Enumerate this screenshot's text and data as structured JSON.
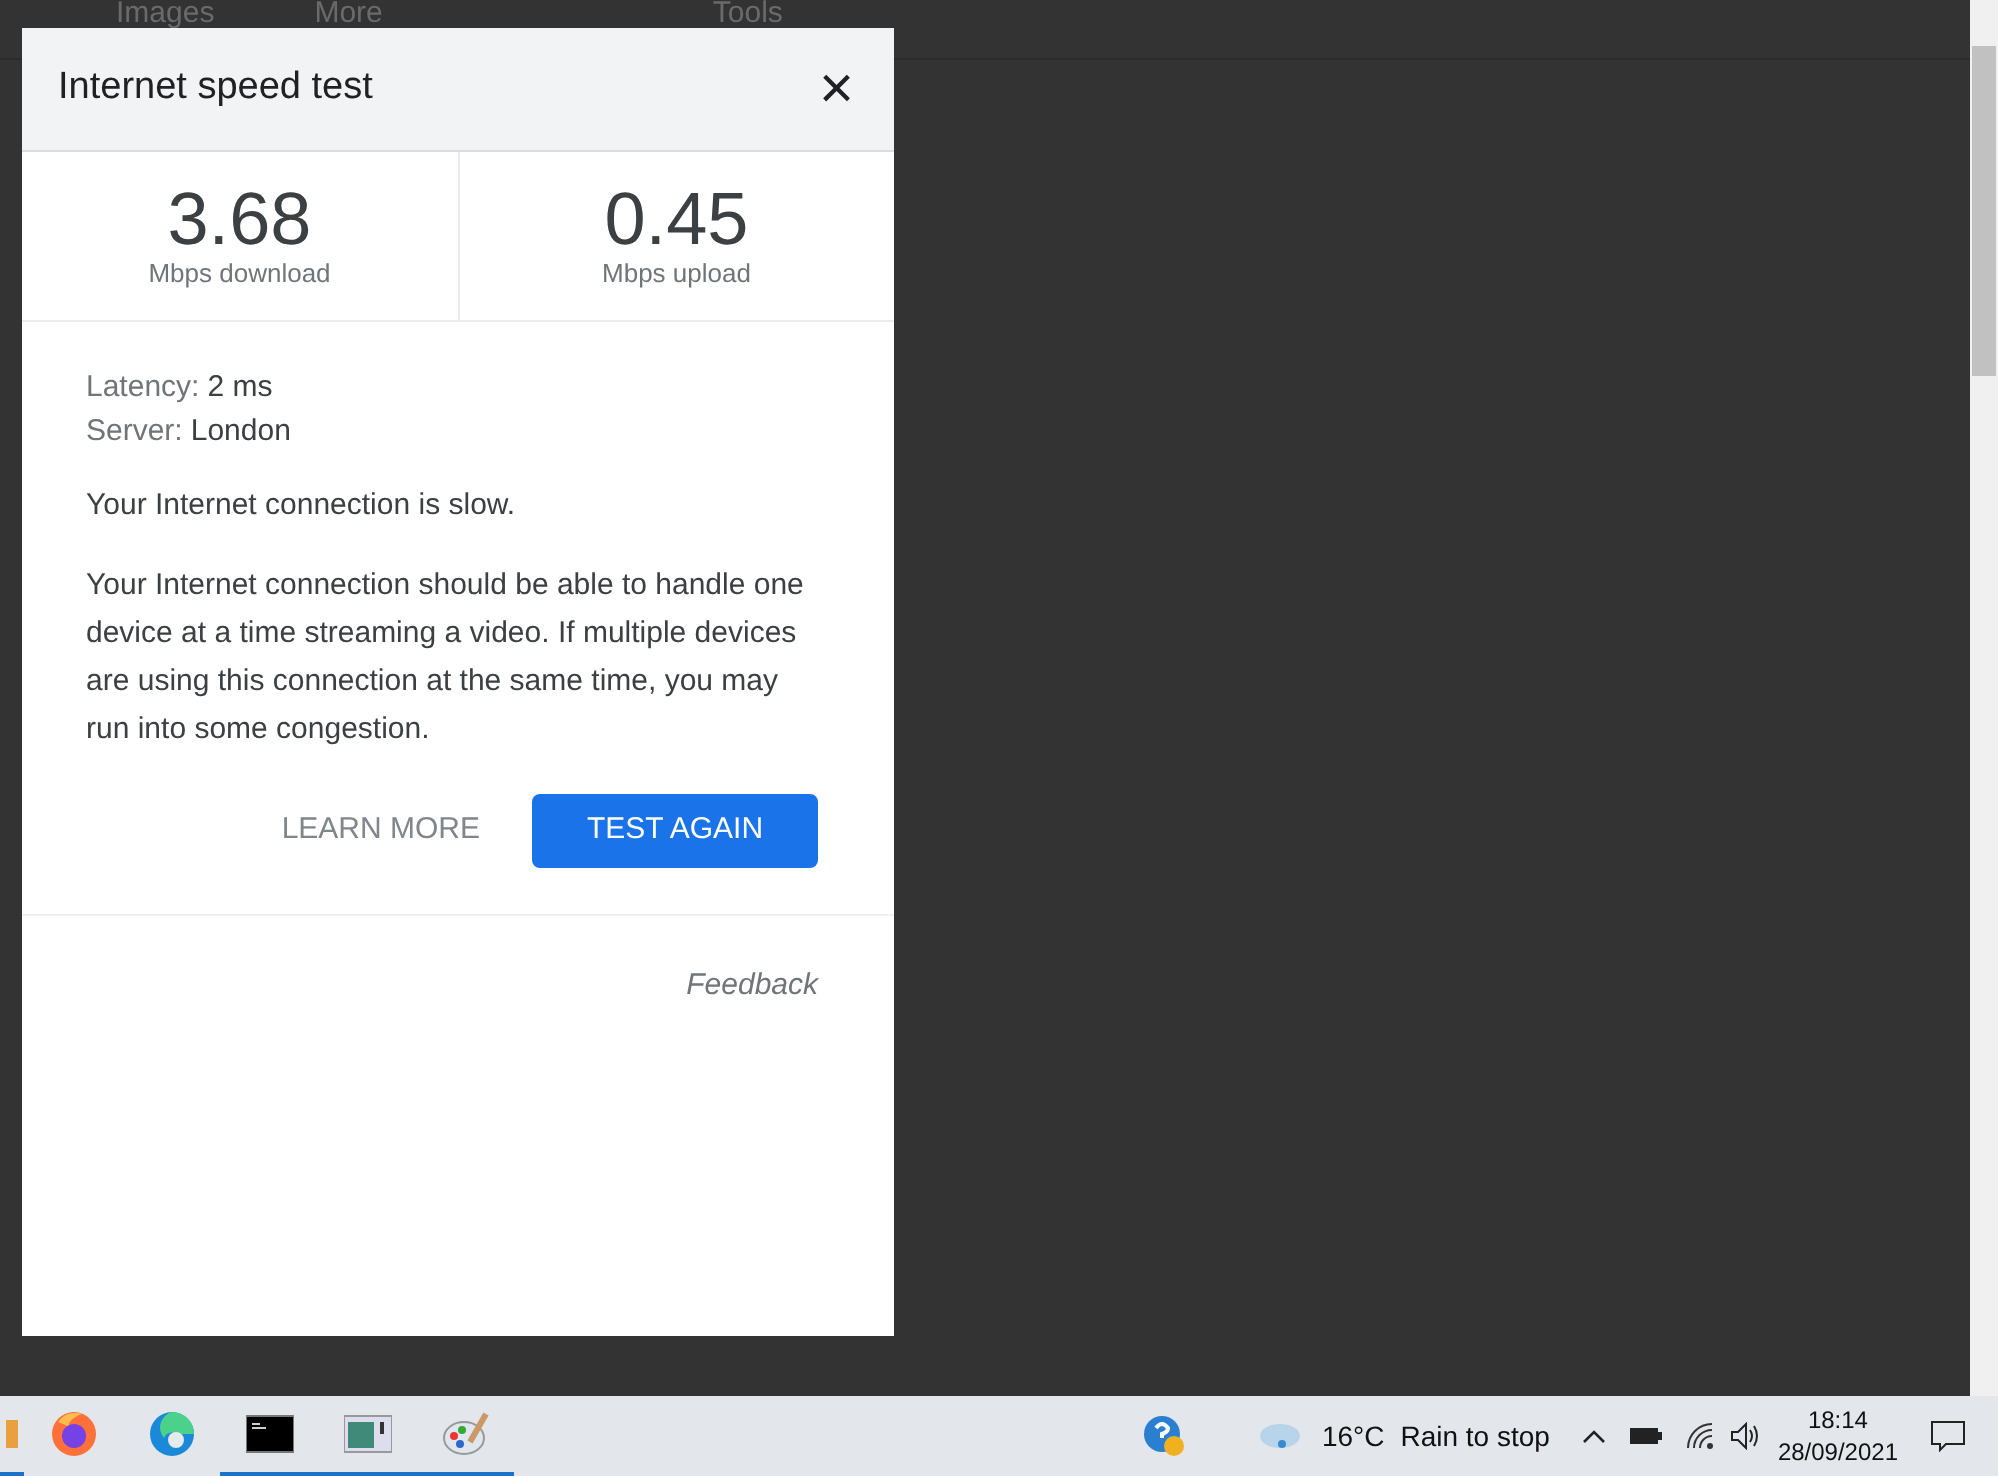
{
  "background": {
    "toolbar": [
      "Images",
      "More",
      "Tools"
    ]
  },
  "dialog": {
    "title": "Internet speed test",
    "close": "×",
    "speeds": [
      {
        "value": "3.68",
        "label": "Mbps download"
      },
      {
        "value": "0.45",
        "label": "Mbps upload"
      }
    ],
    "details": [
      {
        "label": "Latency:",
        "value": "2 ms"
      },
      {
        "label": "Server:",
        "value": "London"
      }
    ],
    "status": "Your Internet connection is slow.",
    "description": "Your Internet connection should be able to handle one device at a time streaming a video. If multiple devices are using this connection at the same time, you may run into some congestion.",
    "buttons": [
      {
        "label": "LEARN MORE",
        "kind": "text"
      },
      {
        "label": "TEST AGAIN",
        "kind": "primary"
      }
    ],
    "feedback": "Feedback"
  },
  "taskbar": {
    "apps": [
      {
        "kind": "partial",
        "running": true
      },
      {
        "kind": "firefox",
        "running": false
      },
      {
        "kind": "edge",
        "running": false
      },
      {
        "kind": "terminal",
        "running": true
      },
      {
        "kind": "window",
        "running": true
      },
      {
        "kind": "paint",
        "running": true
      }
    ],
    "weather": {
      "temperature": "16°C",
      "condition": "Rain to stop"
    },
    "time": "18:14",
    "date": "28/09/2021"
  }
}
